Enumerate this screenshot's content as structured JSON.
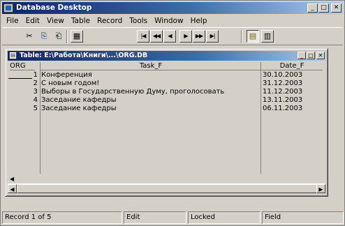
{
  "window": {
    "title": "Database Desktop",
    "minimize": "_",
    "maximize": "□",
    "close": "✕"
  },
  "menu": [
    "File",
    "Edit",
    "View",
    "Table",
    "Record",
    "Tools",
    "Window",
    "Help"
  ],
  "toolbar": {
    "cut_icon": "✂",
    "copy_icon": "⎘",
    "paste_icon": "⎗",
    "restructure_icon": "▦",
    "nav": [
      "|◀",
      "◀◀",
      "◀",
      "▶",
      "▶▶",
      "▶|"
    ],
    "view_icon": "▤",
    "edit_icon": "▥"
  },
  "table_window": {
    "title": "Table: E:\\Работа\\Книги\\...\\ORG.DB",
    "minimize": "_",
    "maximize": "□",
    "close": "✕",
    "columns": [
      "ORG",
      "Task_F",
      "Date_F"
    ],
    "rows": [
      {
        "num": "1",
        "task": "Конференция",
        "date": "30.10.2003"
      },
      {
        "num": "2",
        "task": "С новым годом!",
        "date": "31.12.2003"
      },
      {
        "num": "3",
        "task": "Выборы в Государственную Думу, проголосовать",
        "date": "11.12.2003"
      },
      {
        "num": "4",
        "task": "Заседание кафедры",
        "date": "13.11.2003"
      },
      {
        "num": "5",
        "task": "Заседание кафедры",
        "date": "06.11.2003"
      }
    ],
    "scroll_left": "◀",
    "scroll_right": "▶"
  },
  "status": {
    "record": "Record 1 of 5",
    "mode": "Edit",
    "lock": "Locked",
    "field": "Field"
  }
}
